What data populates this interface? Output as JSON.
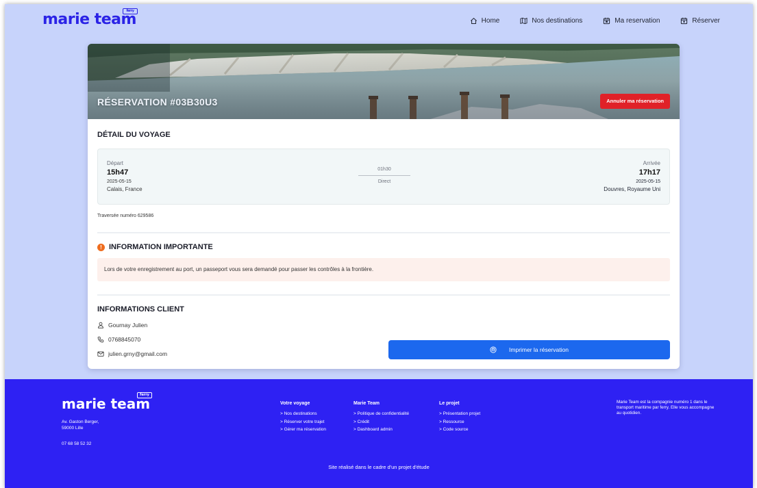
{
  "brand": {
    "logo_text": "marie team",
    "logo_tag": "ferry"
  },
  "nav": [
    {
      "label": "Home",
      "icon": "home-icon"
    },
    {
      "label": "Nos destinations",
      "icon": "map-icon"
    },
    {
      "label": "Ma reservation",
      "icon": "calendar-icon"
    },
    {
      "label": "Réserver",
      "icon": "calendar-plus-icon"
    }
  ],
  "reservation": {
    "title": "RÉSERVATION #03B30U3",
    "cancel_label": "Annuler ma réservation"
  },
  "trip": {
    "section_title": "DÉTAIL DU VOYAGE",
    "departure": {
      "label": "Départ",
      "time": "15h47",
      "date": "2025-05-15",
      "place": "Calais, France"
    },
    "duration": "01h30",
    "type": "Direct",
    "arrival": {
      "label": "Arrivée",
      "time": "17h17",
      "date": "2025-05-15",
      "place": "Douvres, Royaume Uni"
    },
    "crossing_number": "Traversée numéro 629586"
  },
  "important": {
    "title": "INFORMATION IMPORTANTE",
    "text": "Lors de votre enregistrement au port, un passeport vous sera demandé pour passer les contrôles à la frontière."
  },
  "client": {
    "section_title": "INFORMATIONS CLIENT",
    "name": "Gournay Julien",
    "phone": "0768845070",
    "email": "julien.grny@gmail.com"
  },
  "print_label": "Imprimer la réservation",
  "footer": {
    "logo_text": "marie team",
    "address_line1": "Av. Gaston Berger,",
    "address_line2": "59000 Lille",
    "phone": "07 68 58 52 32",
    "columns": [
      {
        "title": "Votre voyage",
        "links": [
          "> Nos destinations",
          "> Réserver votre trajet",
          "> Gérer ma réservation"
        ]
      },
      {
        "title": "Marie Team",
        "links": [
          "> Politique de confidentialité",
          "> Crédit",
          "> Dashboard admin"
        ]
      },
      {
        "title": "Le projet",
        "links": [
          "> Présentation projet",
          "> Ressource",
          "> Code source"
        ]
      }
    ],
    "about": "Marie Team est la compagnie numéro 1 dans le transport maritime par ferry. Elle vous accompagne au quotidien.",
    "bottom": "Site réalisé dans le cadre d'un projet d'étude"
  },
  "colors": {
    "primary": "#2e21f3",
    "background": "#c7d3fb",
    "danger": "#e02128",
    "button": "#1c68ee",
    "notice_bg": "#fdf0ec",
    "info_icon": "#ef6d1f"
  }
}
